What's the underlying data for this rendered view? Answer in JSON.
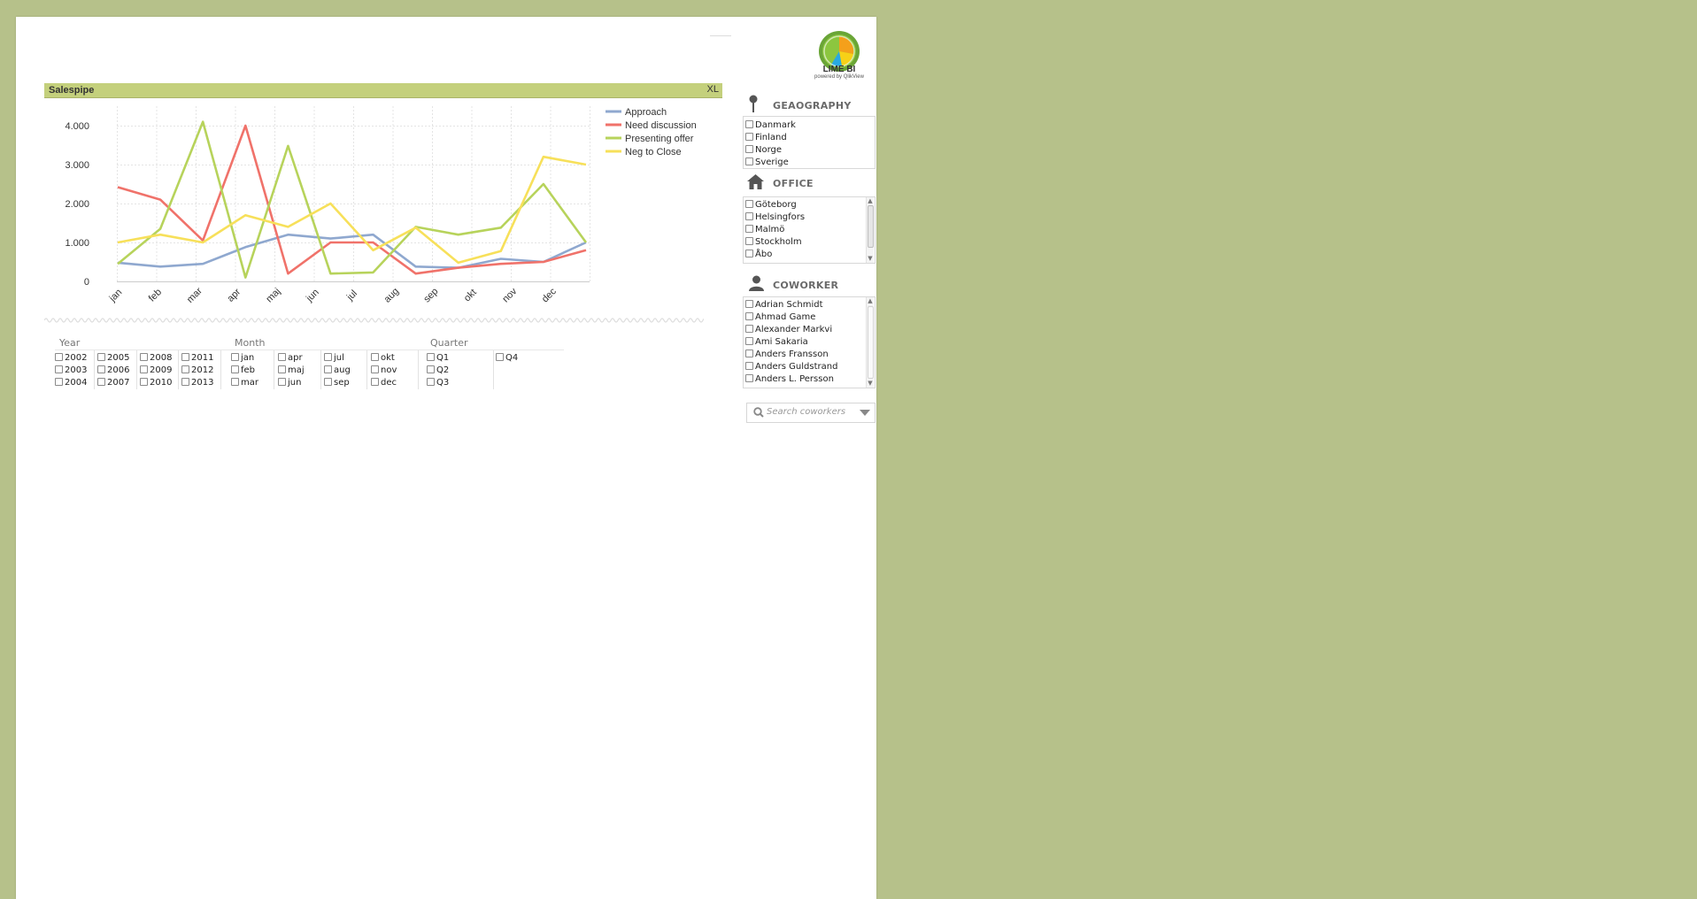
{
  "logo": {
    "name": "LIME BI",
    "tagline": "powered by QlikView"
  },
  "chart": {
    "title": "Salespipe",
    "xl_label": "XL"
  },
  "chart_data": {
    "type": "line",
    "categories": [
      "jan",
      "feb",
      "mar",
      "apr",
      "maj",
      "jun",
      "jul",
      "aug",
      "sep",
      "okt",
      "nov",
      "dec"
    ],
    "ylim": [
      0,
      4500
    ],
    "yticks": [
      0,
      1000,
      2000,
      3000,
      4000
    ],
    "ytick_labels": [
      "0",
      "1.000",
      "2.000",
      "3.000",
      "4.000"
    ],
    "grid": true,
    "legend_position": "top-right",
    "series": [
      {
        "name": "Approach",
        "color": "#8fa8cf",
        "values": [
          480,
          380,
          450,
          880,
          1200,
          1100,
          1200,
          380,
          350,
          580,
          500,
          1000
        ]
      },
      {
        "name": "Need discussion",
        "color": "#f0726a",
        "values": [
          2420,
          2100,
          1050,
          4000,
          200,
          1000,
          1000,
          200,
          350,
          450,
          500,
          800
        ]
      },
      {
        "name": "Presenting offer",
        "color": "#b7d35b",
        "values": [
          450,
          1350,
          4100,
          100,
          3480,
          200,
          230,
          1400,
          1200,
          1380,
          2500,
          1000
        ]
      },
      {
        "name": "Neg to Close",
        "color": "#f7e05a",
        "values": [
          1000,
          1200,
          1000,
          1700,
          1400,
          2000,
          800,
          1380,
          480,
          780,
          3200,
          3000
        ]
      }
    ]
  },
  "filters": {
    "year": {
      "title": "Year",
      "items": [
        "2002",
        "2003",
        "2004",
        "2005",
        "2006",
        "2007",
        "2008",
        "2009",
        "2010",
        "2011",
        "2012",
        "2013"
      ]
    },
    "month": {
      "title": "Month",
      "items": [
        "jan",
        "feb",
        "mar",
        "apr",
        "maj",
        "jun",
        "jul",
        "aug",
        "sep",
        "okt",
        "nov",
        "dec"
      ]
    },
    "quarter": {
      "title": "Quarter",
      "items": [
        "Q1",
        "Q2",
        "Q3",
        "Q4"
      ]
    }
  },
  "sidebar": {
    "geography": {
      "title": "GEAOGRAPHY",
      "items": [
        "Danmark",
        "Finland",
        "Norge",
        "Sverige"
      ]
    },
    "office": {
      "title": "OFFICE",
      "items": [
        "Göteborg",
        "Helsingfors",
        "Malmö",
        "Stockholm",
        "Åbo"
      ]
    },
    "coworker": {
      "title": "COWORKER",
      "items": [
        "Adrian Schmidt",
        "Ahmad Game",
        "Alexander Markvi",
        "Ami Sakaria",
        "Anders Fransson",
        "Anders Guldstrand",
        "Anders L. Persson"
      ]
    },
    "search": {
      "placeholder": "Search coworkers"
    }
  }
}
